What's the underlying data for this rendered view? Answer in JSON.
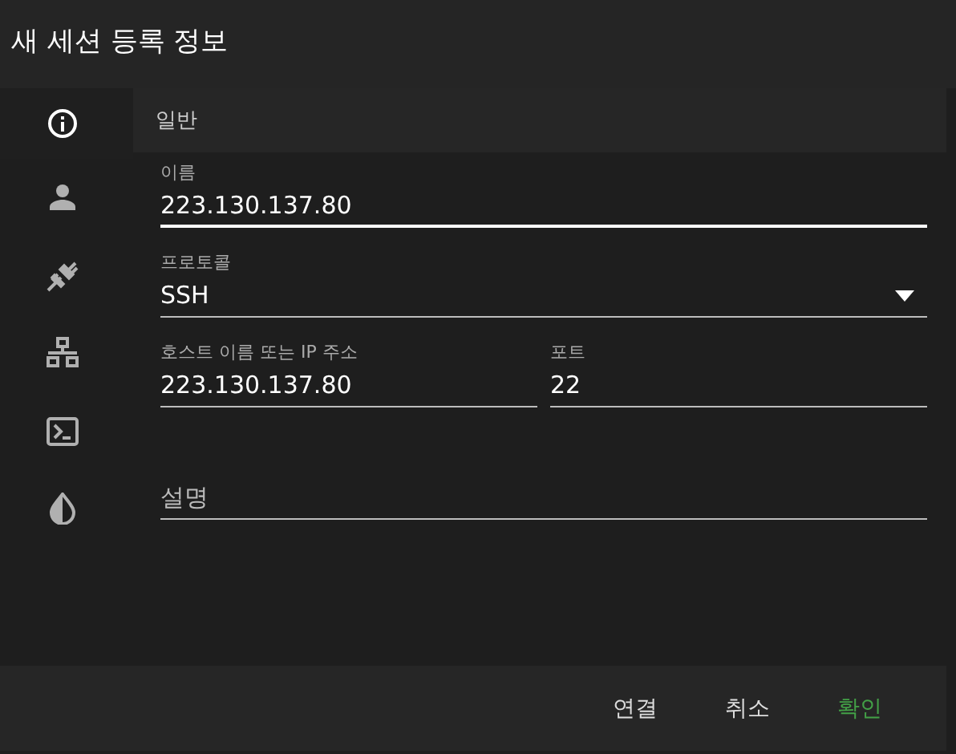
{
  "window": {
    "title": "새 세션 등록 정보"
  },
  "sidebar": {
    "items": [
      {
        "selected": true
      },
      {
        "selected": false
      },
      {
        "selected": false
      },
      {
        "selected": false
      },
      {
        "selected": false
      },
      {
        "selected": false
      }
    ]
  },
  "section": {
    "title": "일반"
  },
  "form_rows": [
    [
      {
        "kind": "text",
        "label": "이름",
        "value": "223.130.137.80",
        "focused": true
      }
    ],
    [
      {
        "kind": "select",
        "label": "프로토콜",
        "value": "SSH",
        "focused": false
      }
    ],
    [
      {
        "kind": "text",
        "label": "호스트 이름 또는 IP 주소",
        "value": "223.130.137.80",
        "focused": false
      },
      {
        "kind": "text",
        "label": "포트",
        "value": "22",
        "focused": false
      }
    ],
    [
      {
        "kind": "text",
        "placeholder": "설명",
        "focused": false
      }
    ]
  ],
  "buttons": [
    {
      "label": "연결",
      "primary": false
    },
    {
      "label": "취소",
      "primary": false
    },
    {
      "label": "확인",
      "primary": true
    }
  ]
}
